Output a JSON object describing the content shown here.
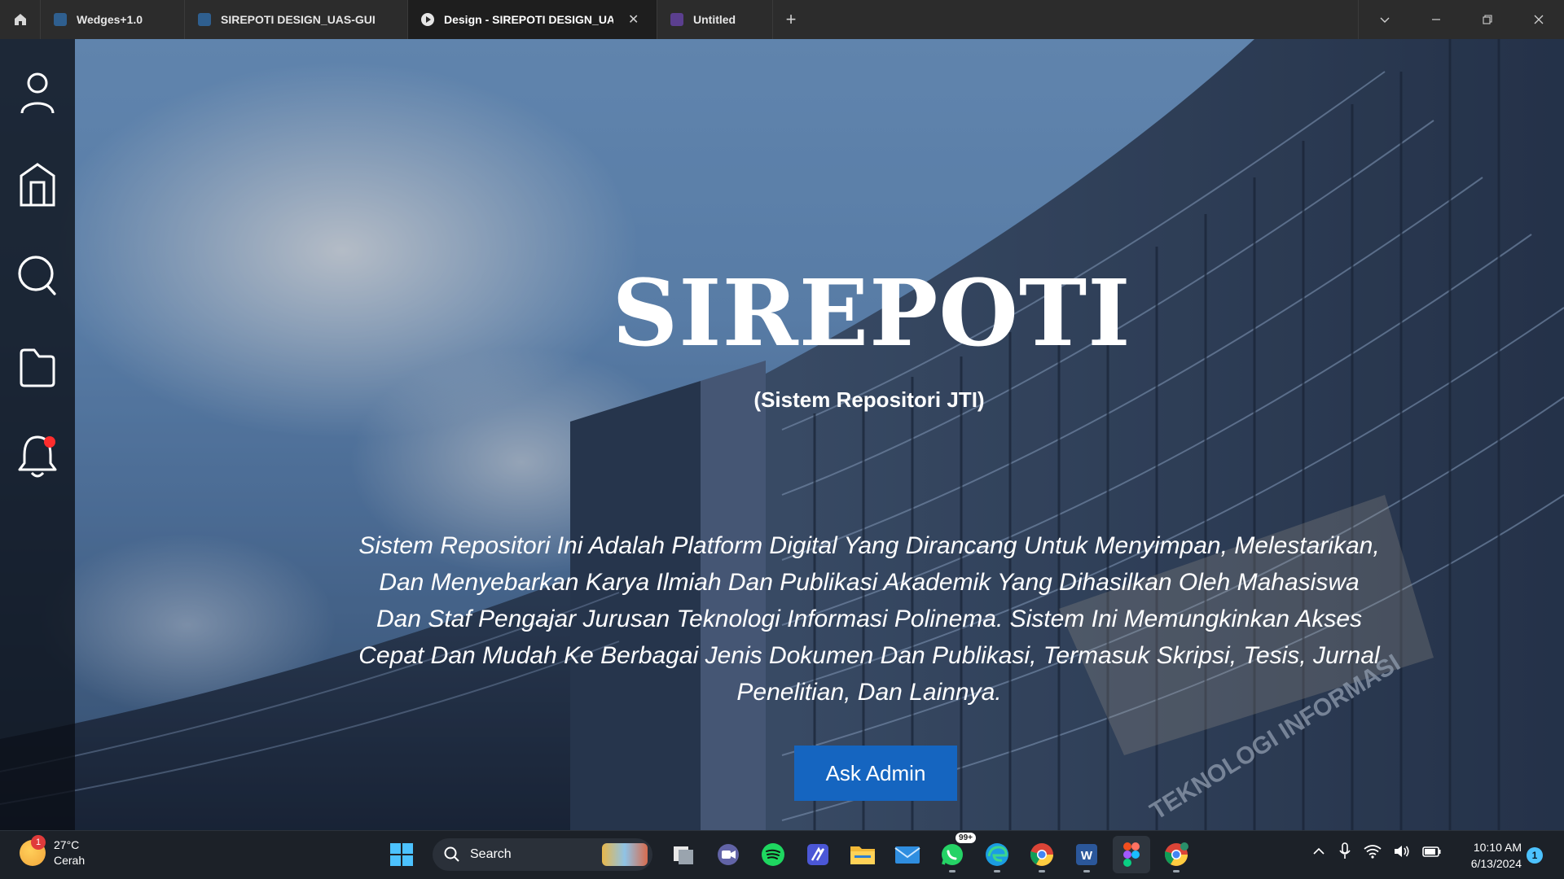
{
  "tabs": [
    {
      "label": "Wedges+1.0",
      "icon": "figma-file-icon",
      "active": false
    },
    {
      "label": "SIREPOTI DESIGN_UAS-GUI",
      "icon": "figma-file-icon",
      "active": false
    },
    {
      "label": "Design - SIREPOTI DESIGN_UAS-G",
      "icon": "figma-prototype-play-icon",
      "active": true
    },
    {
      "label": "Untitled",
      "icon": "figjam-file-icon",
      "active": false
    }
  ],
  "sidebar": {
    "items": [
      {
        "name": "user-icon"
      },
      {
        "name": "building-icon"
      },
      {
        "name": "search-icon"
      },
      {
        "name": "folder-icon"
      },
      {
        "name": "bell-icon",
        "has_notification": true
      }
    ]
  },
  "hero": {
    "title": "SIREPOTI",
    "subtitle": "(Sistem Repositori JTI)",
    "description": "Sistem Repositori Ini Adalah Platform Digital Yang Dirancang Untuk Menyimpan, Melestarikan, Dan Menyebarkan Karya Ilmiah Dan Publikasi Akademik Yang Dihasilkan Oleh Mahasiswa Dan Staf Pengajar Jurusan Teknologi Informasi Polinema. Sistem Ini Memungkinkan Akses Cepat Dan Mudah Ke Berbagai Jenis Dokumen Dan Publikasi, Termasuk Skripsi, Tesis,  Jurnal Penelitian, Dan Lainnya.",
    "button_label": "Ask Admin",
    "building_sign": "TEKNOLOGI INFORMASI"
  },
  "taskbar": {
    "weather": {
      "temp": "27°C",
      "condition": "Cerah",
      "badge": "1"
    },
    "search_label": "Search",
    "apps": [
      "windows-start-icon",
      "task-view-icon",
      "meet-icon",
      "spotify-icon",
      "app-icon",
      "file-explorer-icon",
      "mail-icon",
      "whatsapp-icon",
      "edge-icon",
      "chrome-icon",
      "word-icon",
      "figma-icon",
      "chrome-profile-icon"
    ],
    "whatsapp_badge": "99+",
    "clock": {
      "time": "10:10 AM",
      "date": "6/13/2024"
    },
    "notification_count": "1"
  },
  "colors": {
    "accent_button": "#1565c0",
    "notification_dot": "#ff2d2d",
    "taskbar_bg": "#1c2128"
  }
}
